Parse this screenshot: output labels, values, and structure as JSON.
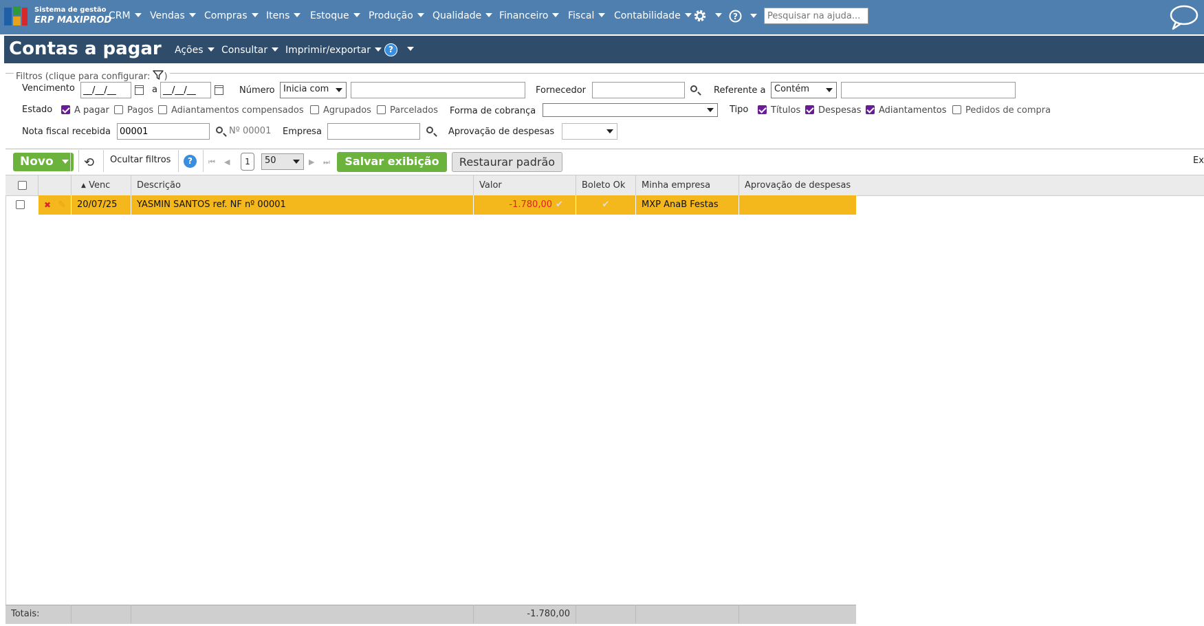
{
  "app": {
    "logo_line1": "Sistema de gestão",
    "logo_line2": "ERP MAXIPROD",
    "nav": [
      "CRM",
      "Vendas",
      "Compras",
      "Itens",
      "Estoque",
      "Produção",
      "Qualidade",
      "Financeiro",
      "Fiscal",
      "Contabilidade"
    ],
    "help_search_placeholder": "Pesquisar na ajuda...",
    "icons": [
      "gear-icon",
      "question-icon",
      "chat-icon"
    ]
  },
  "titlebar": {
    "title": "Contas a pagar",
    "menus": [
      "Ações",
      "Consultar",
      "Imprimir/exportar"
    ]
  },
  "filters": {
    "legend": "Filtros (clique para configurar:",
    "legend_end": ")",
    "vencimento_label": "Vencimento",
    "date_from": "__/__/__",
    "date_sep": "a",
    "date_to": "__/__/__",
    "numero_label": "Número",
    "numero_mode": "Inicia com",
    "numero_value": "",
    "fornecedor_label": "Fornecedor",
    "fornecedor_value": "",
    "referente_label": "Referente a",
    "referente_mode": "Contém",
    "referente_value": "",
    "estado_label": "Estado",
    "estado_options": [
      {
        "label": "A pagar",
        "checked": true
      },
      {
        "label": "Pagos",
        "checked": false
      },
      {
        "label": "Adiantamentos compensados",
        "checked": false
      },
      {
        "label": "Agrupados",
        "checked": false
      },
      {
        "label": "Parcelados",
        "checked": false
      }
    ],
    "forma_cobranca_label": "Forma de cobrança",
    "forma_cobranca_value": "",
    "tipo_label": "Tipo",
    "tipo_options": [
      {
        "label": "Títulos",
        "checked": true
      },
      {
        "label": "Despesas",
        "checked": true
      },
      {
        "label": "Adiantamentos",
        "checked": true
      },
      {
        "label": "Pedidos de compra",
        "checked": false
      }
    ],
    "nota_fiscal_label": "Nota fiscal recebida",
    "nota_fiscal_value": "00001",
    "nota_fiscal_info": "Nº 00001",
    "empresa_label": "Empresa",
    "empresa_value": "",
    "aprovacao_label": "Aprovação de despesas",
    "aprovacao_value": ""
  },
  "toolbar": {
    "novo_label": "Novo",
    "hide_filters_label": "Ocultar filtros",
    "page_number": "1",
    "page_size": "50",
    "save_view_label": "Salvar exibição",
    "restore_default_label": "Restaurar padrão",
    "export_label": "Ex"
  },
  "grid": {
    "columns": [
      "Venc",
      "Descrição",
      "Valor",
      "Boleto Ok",
      "Minha empresa",
      "Aprovação de despesas"
    ],
    "rows": [
      {
        "venc": "20/07/25",
        "descricao": "YASMIN SANTOS ref. NF nº 00001",
        "valor": "-1.780,00",
        "boleto_ok": true,
        "empresa": "MXP AnaB Festas",
        "aprovacao": ""
      }
    ],
    "totals_label": "Totais:",
    "totals_valor": "-1.780,00"
  },
  "colors": {
    "nav_bg": "#4f7fae",
    "title_bg": "#2f4c6a",
    "row_highlight": "#f5b81c",
    "green": "#6cb33e",
    "negative": "#e02020",
    "checkbox": "#6a1b9a"
  }
}
